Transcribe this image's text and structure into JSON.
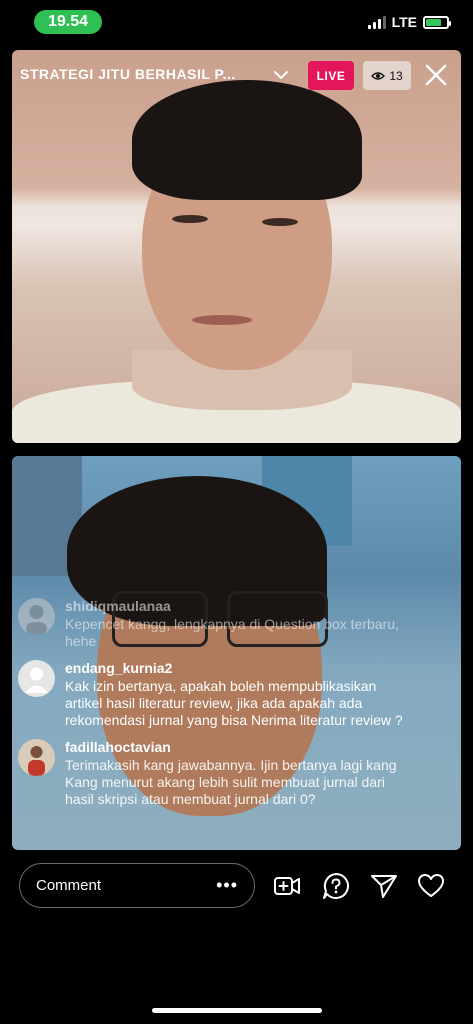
{
  "status_bar": {
    "time": "19.54",
    "network": "LTE"
  },
  "header": {
    "title": "STRATEGI JITU BERHASIL P...",
    "live_label": "LIVE",
    "viewer_count": "13"
  },
  "comments": [
    {
      "user": "shidiqmaulanaa",
      "text": "Kepencet kangg, lengkapnya di Question box terbaru, hehe"
    },
    {
      "user": "endang_kurnia2",
      "text": "Kak izin bertanya, apakah boleh mempublikasikan artikel hasil literatur review, jika ada apakah ada rekomendasi jurnal yang bisa Nerima literatur review ?"
    },
    {
      "user": "fadillahoctavian",
      "text": "Terimakasih kang jawabannya. Ijin bertanya lagi kang Kang menurut akang lebih sulit membuat jurnal dari hasil skripsi atau membuat jurnal dari 0?"
    }
  ],
  "composer": {
    "placeholder": "Comment",
    "more": "•••"
  },
  "colors": {
    "live": "#e3165b",
    "time_pill": "#2fbf54"
  }
}
